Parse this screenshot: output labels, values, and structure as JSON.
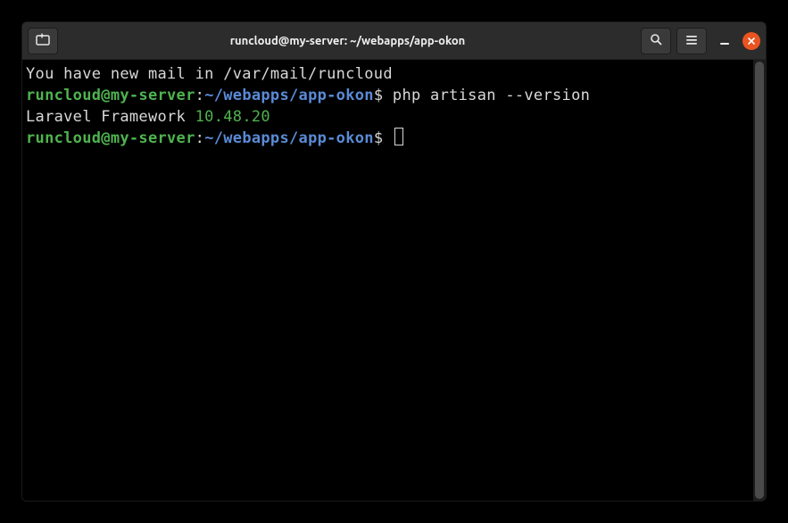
{
  "titlebar": {
    "title": "runcloud@my-server: ~/webapps/app-okon"
  },
  "terminal": {
    "mail_line": "You have new mail in /var/mail/runcloud",
    "prompt1": {
      "userhost": "runcloud@my-server",
      "sep": ":",
      "path": "~/webapps/app-okon",
      "dollar": "$ ",
      "command": "php artisan --version"
    },
    "output1_prefix": "Laravel Framework ",
    "output1_version": "10.48.20",
    "prompt2": {
      "userhost": "runcloud@my-server",
      "sep": ":",
      "path": "~/webapps/app-okon",
      "dollar": "$ "
    }
  }
}
